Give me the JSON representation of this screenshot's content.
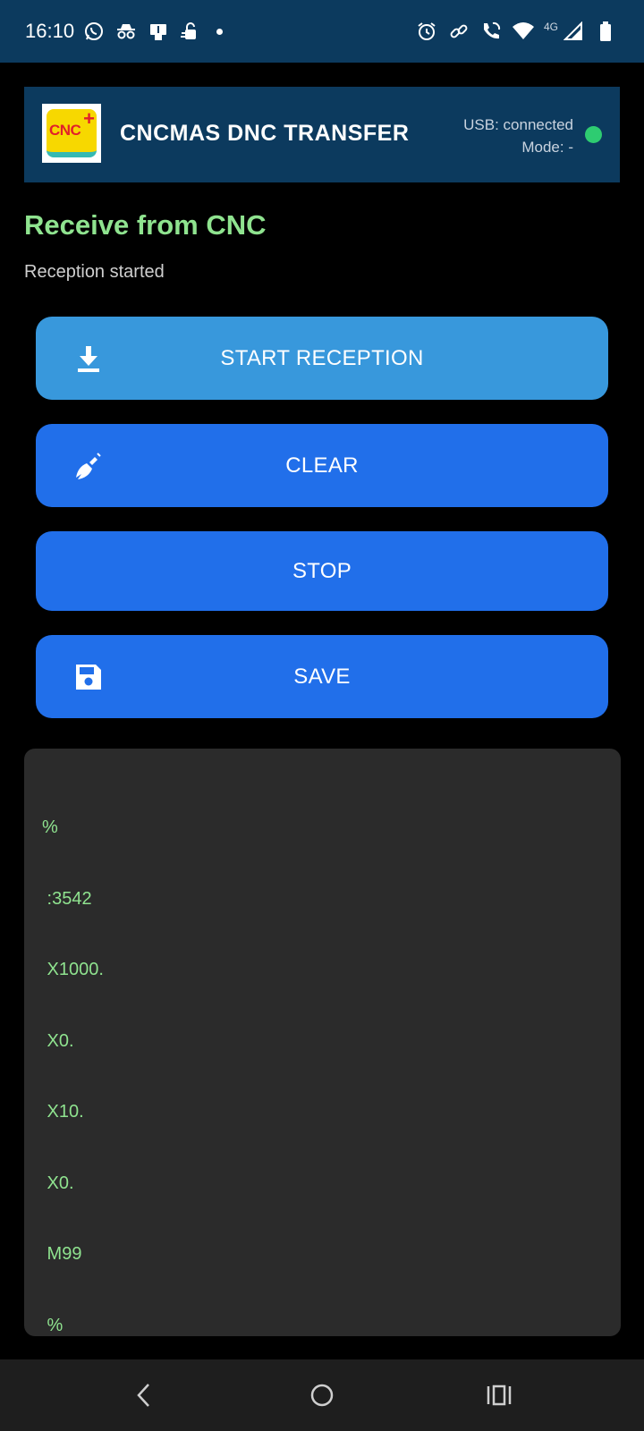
{
  "status_bar": {
    "time": "16:10",
    "network_label": "4G",
    "left_icons": [
      "whatsapp-icon",
      "incognito-icon",
      "sim-toolkit-icon",
      "security-icon",
      "notification-dot"
    ],
    "right_icons": [
      "alarm-icon",
      "link-icon",
      "wifi-calling-icon",
      "wifi-icon",
      "signal-icon",
      "battery-icon"
    ]
  },
  "header": {
    "logo_text": "CNC",
    "logo_plus": "+",
    "title": "CNCMAS DNC TRANSFER",
    "usb_status": "USB: connected",
    "mode": "Mode: -",
    "status_color": "#2ecc71"
  },
  "section": {
    "title": "Receive from CNC",
    "status": "Reception started"
  },
  "buttons": {
    "start": {
      "label": "START RECEPTION",
      "icon": "download-icon"
    },
    "clear": {
      "label": "CLEAR",
      "icon": "broom-icon"
    },
    "stop": {
      "label": "STOP"
    },
    "save": {
      "label": "SAVE",
      "icon": "save-icon"
    }
  },
  "output": {
    "lines": [
      "%",
      " :3542",
      " X1000.",
      " X0.",
      " X10.",
      " X0.",
      " M99",
      " %"
    ]
  },
  "nav": {
    "icons": [
      "back-icon",
      "home-icon",
      "recents-icon"
    ]
  },
  "colors": {
    "accent_green": "#8fe38f",
    "header_bg": "#0c3a5e",
    "primary_button": "#216fea",
    "start_button": "#3898dc"
  }
}
